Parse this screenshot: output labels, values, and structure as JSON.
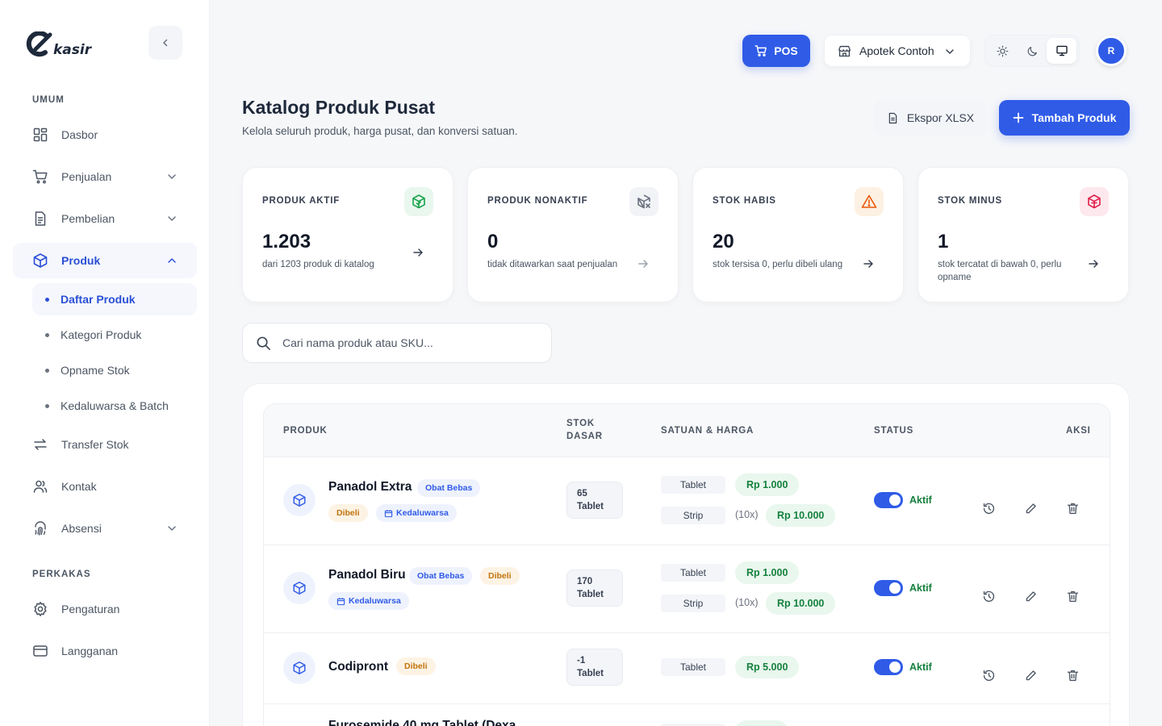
{
  "app": {
    "logo_text": "kasir",
    "avatar_initial": "R"
  },
  "sidebar": {
    "section_general": "UMUM",
    "section_tools": "PERKAKAS",
    "items": [
      {
        "label": "Dasbor",
        "icon": "dashboard-icon"
      },
      {
        "label": "Penjualan",
        "icon": "cart-icon"
      },
      {
        "label": "Pembelian",
        "icon": "document-icon"
      },
      {
        "label": "Produk",
        "icon": "box-icon",
        "active": true
      },
      {
        "label": "Transfer Stok",
        "icon": "transfer-icon"
      },
      {
        "label": "Kontak",
        "icon": "users-icon"
      },
      {
        "label": "Absensi",
        "icon": "fingerprint-icon"
      },
      {
        "label": "Pengaturan",
        "icon": "gear-icon"
      },
      {
        "label": "Langganan",
        "icon": "card-icon"
      }
    ],
    "sub_items": [
      {
        "label": "Daftar Produk",
        "active": true
      },
      {
        "label": "Kategori Produk"
      },
      {
        "label": "Opname Stok"
      },
      {
        "label": "Kedaluwarsa & Batch"
      }
    ]
  },
  "topbar": {
    "pos_label": "POS",
    "store_label": "Apotek Contoh",
    "theme_active": "system"
  },
  "header": {
    "title": "Katalog Produk Pusat",
    "subtitle": "Kelola seluruh produk, harga pusat, dan konversi satuan.",
    "export_label": "Ekspor XLSX",
    "add_label": "Tambah Produk"
  },
  "stats": [
    {
      "label": "PRODUK AKTIF",
      "value": "1.203",
      "desc": "dari 1203 produk di katalog",
      "color": "#16a34a"
    },
    {
      "label": "PRODUK NONAKTIF",
      "value": "0",
      "desc": "tidak ditawarkan saat penjualan",
      "color": "#6b7280"
    },
    {
      "label": "STOK HABIS",
      "value": "20",
      "desc": "stok tersisa 0, perlu dibeli ulang",
      "color": "#ea580c"
    },
    {
      "label": "STOK MINUS",
      "value": "1",
      "desc": "stok tercatat di bawah 0, perlu opname",
      "color": "#e11d48"
    }
  ],
  "search": {
    "placeholder": "Cari nama produk atau SKU..."
  },
  "table": {
    "headers": {
      "product": "PRODUK",
      "stock_line1": "STOK",
      "stock_line2": "DASAR",
      "unit_price": "SATUAN & HARGA",
      "status": "STATUS",
      "action": "AKSI"
    },
    "rows": [
      {
        "name": "Panadol Extra",
        "badge_category": "Obat Bebas",
        "badge_bought": "Dibeli",
        "badge_expiry": "Kedaluwarsa",
        "stock_qty": "65",
        "stock_unit": "Tablet",
        "unit1": "Tablet",
        "price1": "Rp 1.000",
        "unit2": "Strip",
        "mult2": "(10x)",
        "price2": "Rp 10.000",
        "status": "Aktif"
      },
      {
        "name": "Panadol Biru",
        "badge_category": "Obat Bebas",
        "badge_bought": "Dibeli",
        "badge_expiry": "Kedaluwarsa",
        "stock_qty": "170",
        "stock_unit": "Tablet",
        "unit1": "Tablet",
        "price1": "Rp 1.000",
        "unit2": "Strip",
        "mult2": "(10x)",
        "price2": "Rp 10.000",
        "status": "Aktif"
      },
      {
        "name": "Codipront",
        "badge_bought": "Dibeli",
        "stock_qty": "-1",
        "stock_unit": "Tablet",
        "unit1": "Tablet",
        "price1": "Rp 5.000",
        "status": "Aktif"
      },
      {
        "name": "Furosemide 40 mg Tablet (Dexa"
      }
    ]
  }
}
